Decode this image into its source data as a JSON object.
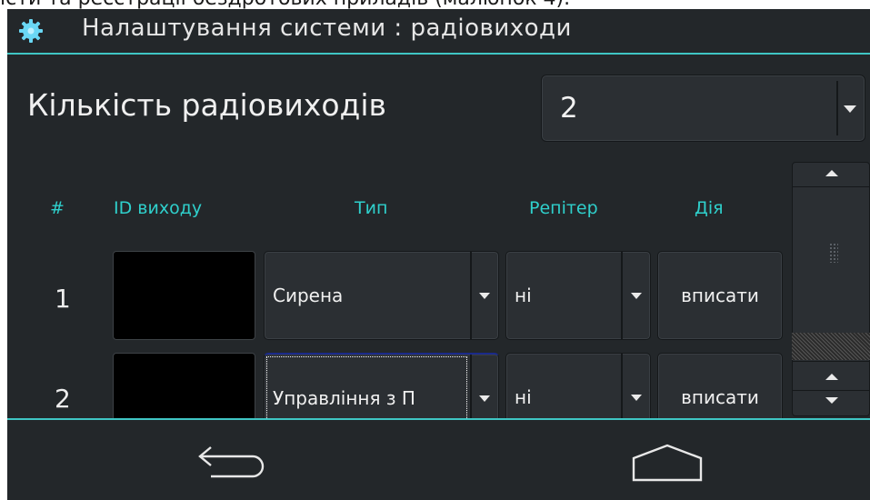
{
  "doc_caption": "істи та реєстрації бездротових приладів (малюнок 4).",
  "window": {
    "title": "Налаштування системи : радіовиходи",
    "title_icon": "gear-icon"
  },
  "count": {
    "label": "Кількість радіовиходів",
    "value": "2"
  },
  "table": {
    "headers": [
      "#",
      "ID виходу",
      "Тип",
      "Репітер",
      "Дія"
    ],
    "rows": [
      {
        "num": "1",
        "id": "",
        "type": "Сирена",
        "repeater": "ні",
        "action": "вписати"
      },
      {
        "num": "2",
        "id": "",
        "type": "Управління з П",
        "repeater": "ні",
        "action": "вписати"
      }
    ]
  },
  "colors": {
    "accent": "#3fc6c4",
    "header_text": "#2fd0cc",
    "background": "#23272a"
  },
  "nav": {
    "back_icon": "back-arrow-icon",
    "home_icon": "home-icon"
  }
}
